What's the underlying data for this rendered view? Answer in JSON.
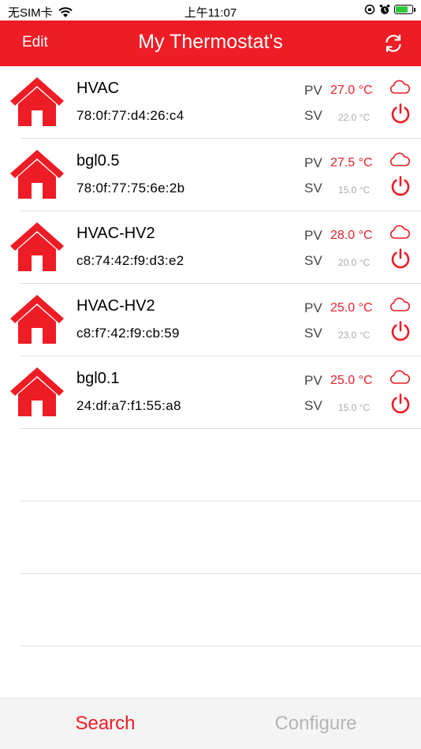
{
  "status_bar": {
    "carrier": "无SIM卡",
    "time": "上午11:07",
    "battery_level": 0.85
  },
  "nav": {
    "edit_label": "Edit",
    "title": "My Thermostat's",
    "refresh_icon": "refresh-icon"
  },
  "devices": [
    {
      "name": "HVAC",
      "mac": "78:0f:77:d4:26:c4",
      "pv_label": "PV",
      "pv": "27.0 °C",
      "sv_label": "SV",
      "sv": "22.0 °C"
    },
    {
      "name": "bgl0.5",
      "mac": "78:0f:77:75:6e:2b",
      "pv_label": "PV",
      "pv": "27.5 °C",
      "sv_label": "SV",
      "sv": "15.0 °C"
    },
    {
      "name": "HVAC-HV2",
      "mac": "c8:74:42:f9:d3:e2",
      "pv_label": "PV",
      "pv": "28.0 °C",
      "sv_label": "SV",
      "sv": "20.0 °C"
    },
    {
      "name": "HVAC-HV2",
      "mac": "c8:f7:42:f9:cb:59",
      "pv_label": "PV",
      "pv": "25.0 °C",
      "sv_label": "SV",
      "sv": "23.0 °C"
    },
    {
      "name": "bgl0.1",
      "mac": "24:df:a7:f1:55:a8",
      "pv_label": "PV",
      "pv": "25.0 °C",
      "sv_label": "SV",
      "sv": "15.0 °C"
    }
  ],
  "tabs": [
    {
      "label": "Search",
      "active": true
    },
    {
      "label": "Configure",
      "active": false
    }
  ],
  "colors": {
    "accent": "#ee1c25",
    "pv_value": "#e8232b",
    "sv_value": "#aaaaaa"
  }
}
